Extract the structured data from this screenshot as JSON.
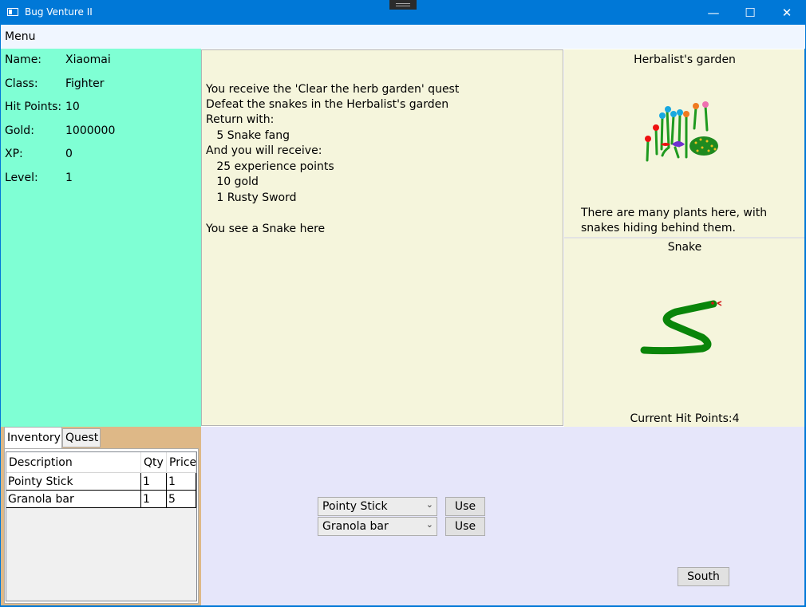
{
  "window": {
    "title": "Bug Venture II",
    "minimize_glyph": "—",
    "maximize_glyph": "☐",
    "close_glyph": "✕"
  },
  "menu": {
    "label": "Menu"
  },
  "player": {
    "rows": [
      {
        "label": "Name:",
        "value": "Xiaomai"
      },
      {
        "label": "Class:",
        "value": "Fighter"
      },
      {
        "label": "Hit Points:",
        "value": "10"
      },
      {
        "label": "Gold:",
        "value": "1000000"
      },
      {
        "label": "XP:",
        "value": "0"
      },
      {
        "label": "Level:",
        "value": "1"
      }
    ]
  },
  "messages": [
    "You receive the 'Clear the herb garden' quest",
    "Defeat the snakes in the Herbalist's garden",
    "Return with:",
    "   5 Snake fang",
    "And you will receive:",
    "   25 experience points",
    "   10 gold",
    "   1 Rusty Sword",
    "",
    "You see a Snake here"
  ],
  "location": {
    "name": "Herbalist's garden",
    "description": "There are many plants here, with snakes hiding behind them."
  },
  "monster": {
    "name": "Snake",
    "hit_points_text": "Current Hit Points:4"
  },
  "tabs": [
    {
      "label": "Inventory"
    },
    {
      "label": "Quest"
    }
  ],
  "inventory": {
    "columns": [
      "Description",
      "Qty",
      "Price"
    ],
    "rows": [
      [
        "Pointy Stick",
        "1",
        "1"
      ],
      [
        "Granola bar",
        "1",
        "5"
      ]
    ]
  },
  "actions": {
    "weapon_select": "Pointy Stick",
    "consumable_select": "Granola bar",
    "use_label": "Use",
    "move_label": "South"
  },
  "colors": {
    "titlebar": "#0078d7",
    "stats_bg": "#7fffd4",
    "panel_bg": "#f5f5dc",
    "tab_strip_bg": "#deb887",
    "actions_bg": "#e6e6fa"
  }
}
